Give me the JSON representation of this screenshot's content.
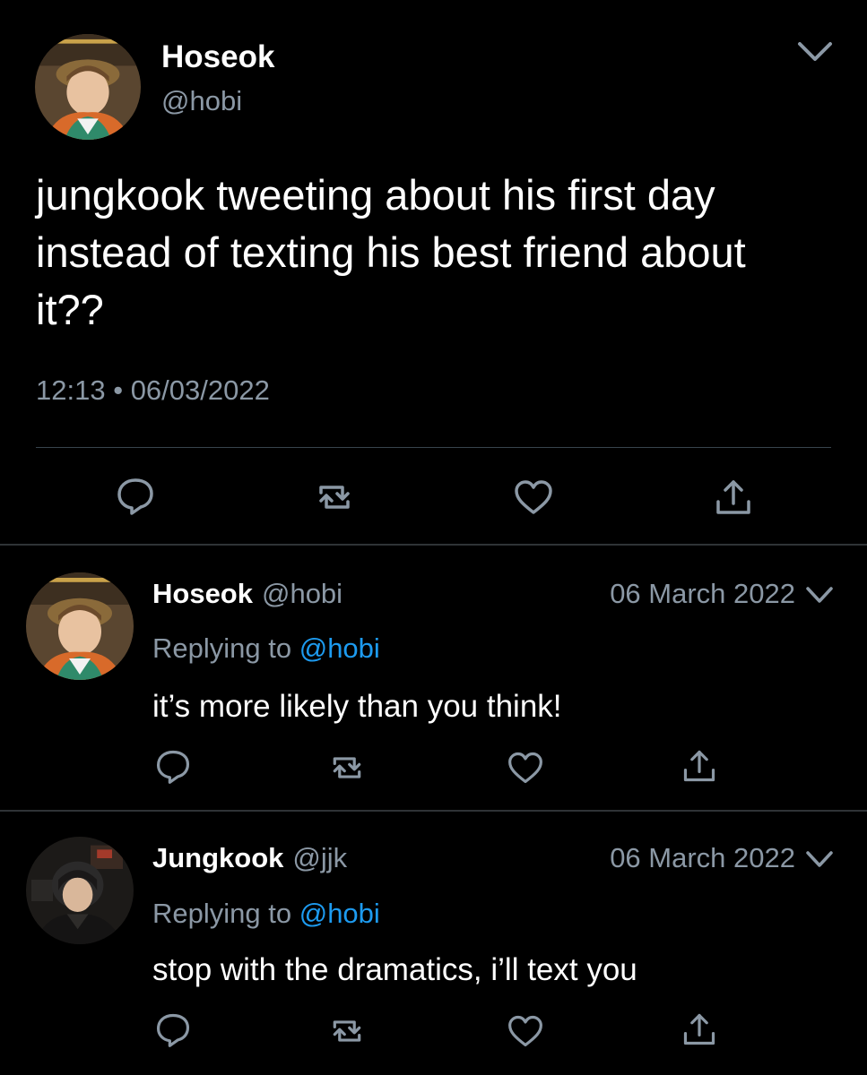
{
  "main_tweet": {
    "display_name": "Hoseok",
    "handle": "@hobi",
    "text": "jungkook tweeting about his first day\ninstead of texting his best friend about\nit??",
    "time": "12:13",
    "separator": "•",
    "date": "06/03/2022",
    "avatar_icon": "user-avatar",
    "menu_icon": "chevron-down-icon"
  },
  "actions": {
    "reply_icon": "reply-icon",
    "retweet_icon": "retweet-icon",
    "like_icon": "heart-icon",
    "share_icon": "share-icon"
  },
  "replies": [
    {
      "display_name": "Hoseok",
      "handle": "@hobi",
      "date": "06 March 2022",
      "replying_prefix": "Replying to",
      "replying_to": "@hobi",
      "text": "it’s more likely than you think!"
    },
    {
      "display_name": "Jungkook",
      "handle": "@jjk",
      "date": "06 March 2022",
      "replying_prefix": "Replying to",
      "replying_to": "@hobi",
      "text": "stop with the dramatics, i’ll text you"
    }
  ],
  "colors": {
    "background": "#000000",
    "primary_text": "#ffffff",
    "secondary_text": "#8b98a5",
    "link": "#1d9bf0",
    "divider": "#2f3336"
  }
}
